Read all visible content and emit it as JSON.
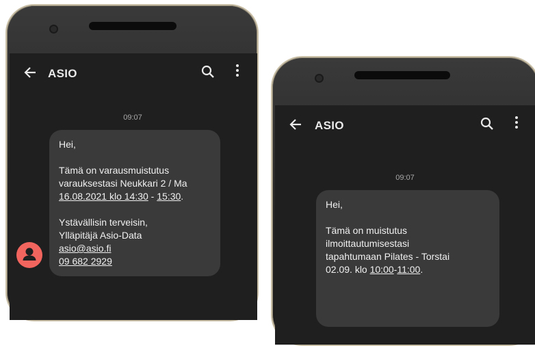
{
  "phone1": {
    "title": "ASIO",
    "time": "09:07",
    "message": {
      "greeting": "Hei,",
      "line1": "Tämä on varausmuistutus",
      "line2": "varauksestasi Neukkari 2 / Ma",
      "date_time": "16.08.2021 klo 14:30",
      "sep": " - ",
      "end_time": "15:30",
      "end_punct": ".",
      "sig1": "Ystävällisin terveisin,",
      "sig2": "Ylläpitäjä Asio-Data",
      "email": "asio@asio.fi",
      "phone": "09 682 2929"
    }
  },
  "phone2": {
    "title": "ASIO",
    "time": "09:07",
    "message": {
      "greeting": "Hei,",
      "line1": "Tämä on muistutus",
      "line2": "ilmoittautumisestasi",
      "line3": "tapahtumaan Pilates - Torstai",
      "line4_prefix": "02.09. klo ",
      "start_time": "10:00",
      "sep": "-",
      "end_time": "11:00",
      "end_punct": "."
    }
  },
  "colors": {
    "screen_bg": "#1f1f1f",
    "bubble_bg": "#3a3a3a",
    "avatar": "#f2655f",
    "frame_edge": "#c9bfa6"
  },
  "icons": [
    "back-arrow-icon",
    "search-icon",
    "more-vert-icon",
    "person-icon"
  ]
}
